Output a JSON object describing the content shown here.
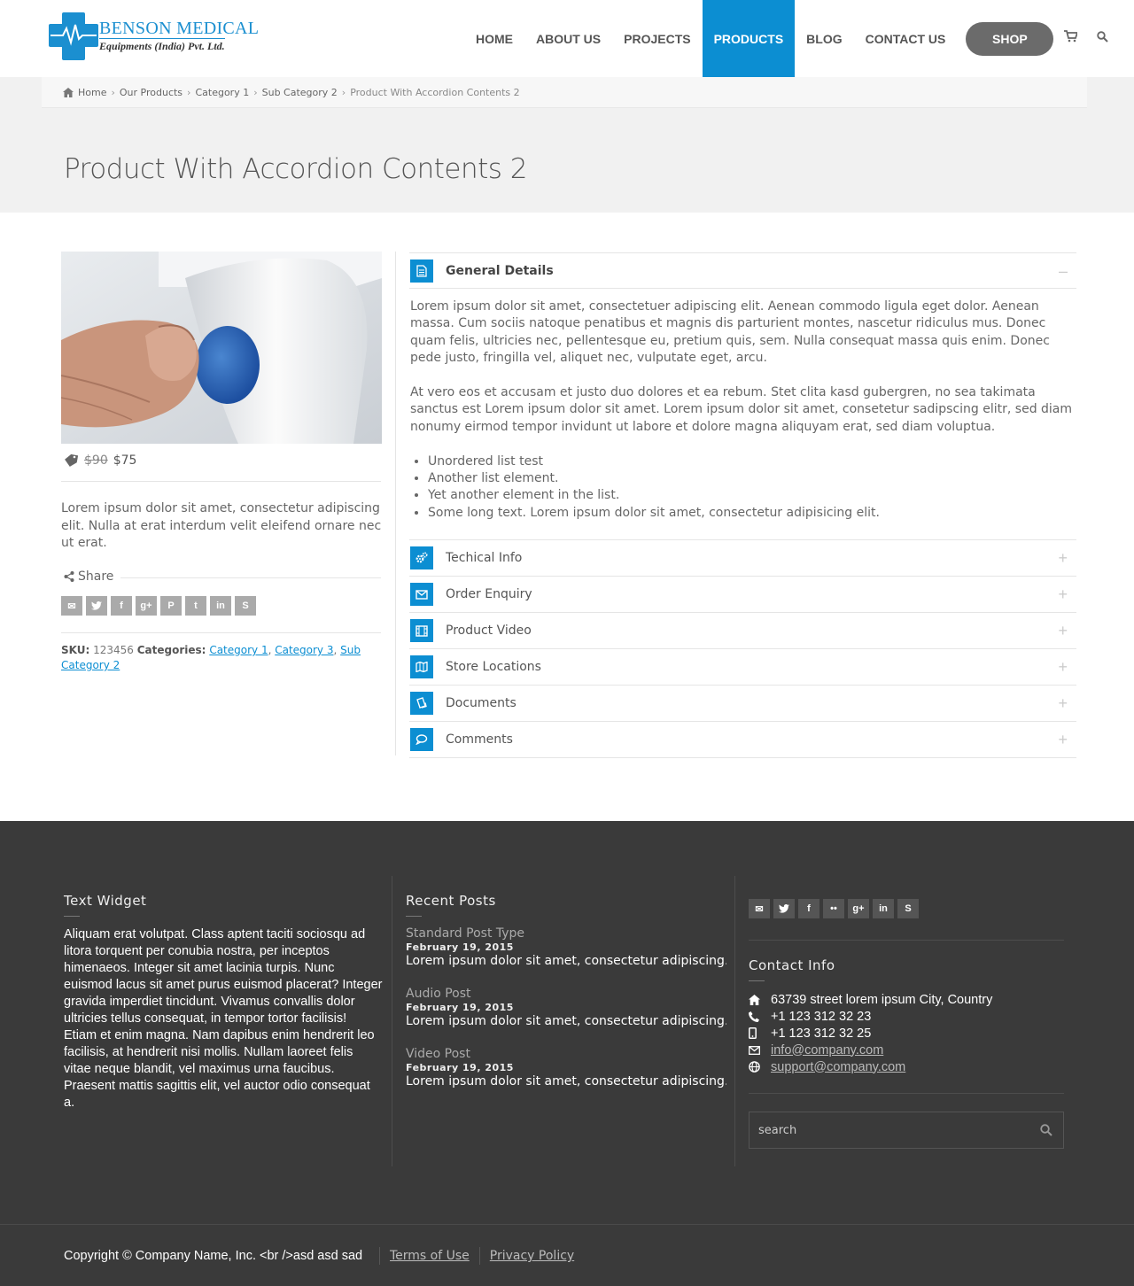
{
  "header": {
    "brand_name": "BENSON MEDICAL",
    "brand_tagline": "Equipments (India) Pvt. Ltd.",
    "nav": [
      {
        "label": "HOME"
      },
      {
        "label": "ABOUT US"
      },
      {
        "label": "PROJECTS"
      },
      {
        "label": "PRODUCTS",
        "active": true
      },
      {
        "label": "BLOG"
      },
      {
        "label": "CONTACT US"
      }
    ],
    "shop_label": "SHOP",
    "accent_color": "#0c8ed2"
  },
  "breadcrumb": {
    "items": [
      "Home",
      "Our Products",
      "Category 1",
      "Sub Category 2"
    ],
    "current": "Product With Accordion Contents 2"
  },
  "page_title": "Product With Accordion Contents 2",
  "product": {
    "old_price": "$90",
    "price": "$75",
    "short_description": "Lorem ipsum dolor sit amet, consectetur adipiscing elit. Nulla at erat interdum velit eleifend ornare nec ut erat.",
    "share_label": "Share",
    "share_icons": [
      "mail-icon",
      "twitter-icon",
      "facebook-icon",
      "google-plus-icon",
      "pinterest-icon",
      "tumblr-icon",
      "linkedin-icon",
      "stumbleupon-icon"
    ],
    "sku_label": "SKU:",
    "sku": "123456",
    "categories_label": "Categories:",
    "categories": [
      "Category 1",
      "Category 3",
      "Sub Category 2"
    ]
  },
  "accordion": {
    "open": {
      "title": "General Details",
      "toggle": "–",
      "paragraph1": "Lorem ipsum dolor sit amet, consectetuer adipiscing elit. Aenean commodo ligula eget dolor. Aenean massa. Cum sociis natoque penatibus et magnis dis parturient montes, nascetur ridiculus mus. Donec quam felis, ultricies nec, pellentesque eu, pretium quis, sem. Nulla consequat massa quis enim. Donec pede justo, fringilla vel, aliquet nec, vulputate eget, arcu.",
      "paragraph2": "At vero eos et accusam et justo duo dolores et ea rebum. Stet clita kasd gubergren, no sea takimata sanctus est Lorem ipsum dolor sit amet. Lorem ipsum dolor sit amet, consetetur sadipscing elitr, sed diam nonumy eirmod tempor invidunt ut labore et dolore magna aliquyam erat, sed diam voluptua.",
      "list": [
        "Unordered list test",
        "Another list element.",
        "Yet another element in the list.",
        "Some long text. Lorem ipsum dolor sit amet, consectetur adipisicing elit."
      ]
    },
    "sections": [
      {
        "title": "Techical Info",
        "icon": "cogs-icon"
      },
      {
        "title": "Order Enquiry",
        "icon": "envelope-icon"
      },
      {
        "title": "Product Video",
        "icon": "film-icon"
      },
      {
        "title": "Store Locations",
        "icon": "map-icon"
      },
      {
        "title": "Documents",
        "icon": "documents-icon"
      },
      {
        "title": "Comments",
        "icon": "comments-icon"
      }
    ],
    "toggle": "+"
  },
  "footer": {
    "text_widget": {
      "title": "Text Widget",
      "body": "Aliquam erat volutpat. Class aptent taciti sociosqu ad litora torquent per conubia nostra, per inceptos himenaeos. Integer sit amet lacinia turpis. Nunc euismod lacus sit amet purus euismod placerat? Integer gravida imperdiet tincidunt. Vivamus convallis dolor ultricies tellus consequat, in tempor tortor facilisis! Etiam et enim magna. Nam dapibus enim hendrerit leo facilisis, at hendrerit nisi mollis. Nullam laoreet felis vitae neque blandit, vel maximus urna faucibus. Praesent mattis sagittis elit, vel auctor odio consequat a."
    },
    "recent_posts": {
      "title": "Recent Posts",
      "posts": [
        {
          "title": "Standard Post Type",
          "date": "February 19, 2015",
          "excerpt": "Lorem ipsum dolor sit amet, consectetur adipiscing..."
        },
        {
          "title": "Audio Post",
          "date": "February 19, 2015",
          "excerpt": "Lorem ipsum dolor sit amet, consectetur adipiscing..."
        },
        {
          "title": "Video Post",
          "date": "February 19, 2015",
          "excerpt": "Lorem ipsum dolor sit amet, consectetur adipiscing..."
        }
      ]
    },
    "social_icons": [
      "mail-icon",
      "twitter-icon",
      "facebook-icon",
      "flickr-icon",
      "google-plus-icon",
      "linkedin-icon",
      "skype-icon"
    ],
    "contact": {
      "title": "Contact Info",
      "address": "63739 street lorem ipsum City, Country",
      "phone": "+1 123 312 32 23",
      "mobile": "+1 123 312 32 25",
      "email": "info@company.com",
      "web": "support@company.com"
    },
    "search_placeholder": "search",
    "copyright": "Copyright © Company Name, Inc. <br />asd asd sad",
    "links": [
      "Terms of Use",
      "Privacy Policy"
    ]
  }
}
